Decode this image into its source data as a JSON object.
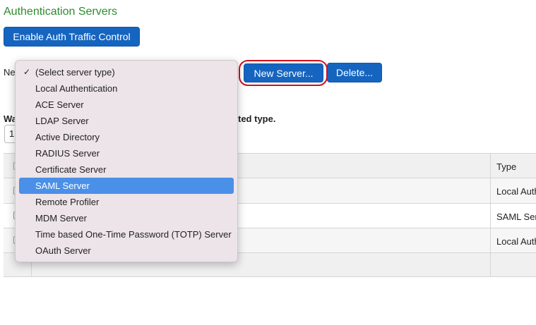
{
  "page": {
    "title": "Authentication Servers",
    "enable_button": "Enable Auth Traffic Control",
    "new_label_partial": "Ne",
    "new_server_button": "New Server...",
    "delete_button": "Delete...",
    "warning_prefix": "Wa",
    "warning_suffix": "ted type.",
    "small_select_value": "1"
  },
  "dropdown": {
    "options": [
      {
        "label": "(Select server type)",
        "checked": true
      },
      {
        "label": "Local Authentication"
      },
      {
        "label": "ACE Server"
      },
      {
        "label": "LDAP Server"
      },
      {
        "label": "Active Directory"
      },
      {
        "label": "RADIUS Server"
      },
      {
        "label": "Certificate Server"
      },
      {
        "label": "SAML Server",
        "highlighted": true
      },
      {
        "label": "Remote Profiler"
      },
      {
        "label": "MDM Server"
      },
      {
        "label": "Time based One-Time Password (TOTP) Server"
      },
      {
        "label": "OAuth Server"
      }
    ],
    "checkmark": "✓",
    "highlight_color": "#4a90e8"
  },
  "table": {
    "header_type": "Type",
    "rows": [
      {
        "type": "Local Auth"
      },
      {
        "type": "SAML Ser"
      },
      {
        "type": "Local Auth"
      }
    ]
  },
  "colors": {
    "button": "#1565c0",
    "title": "#2e8b2e",
    "highlight_ring": "#d0121d"
  }
}
